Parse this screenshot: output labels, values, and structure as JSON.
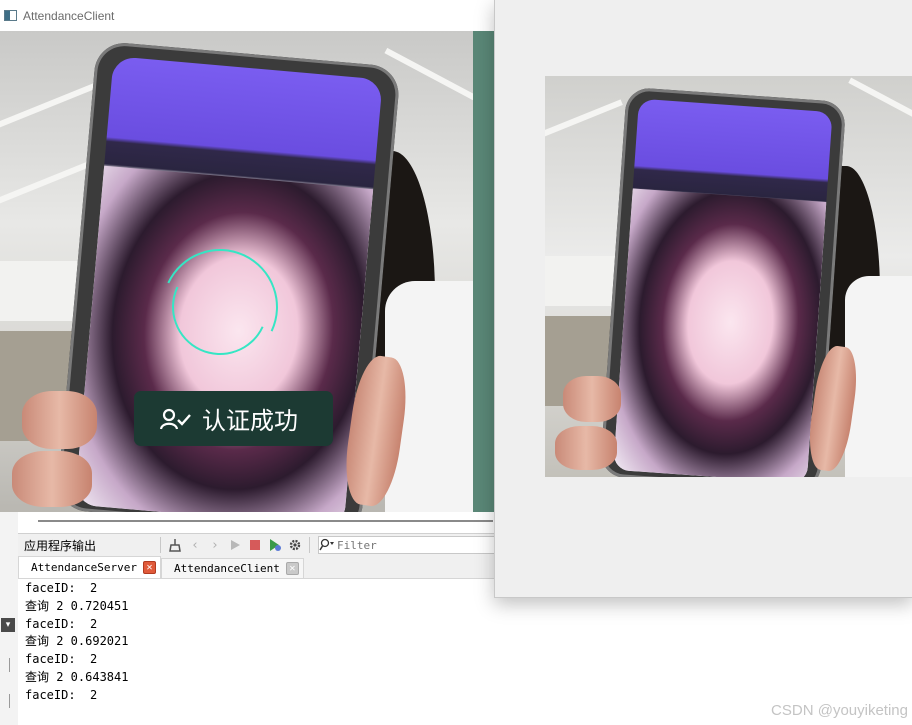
{
  "client_window": {
    "title": "AttendanceClient",
    "toast": {
      "text": "认证成功",
      "icon": "user-check-icon"
    }
  },
  "output_panel": {
    "title": "应用程序输出",
    "filter_placeholder": "Filter",
    "tabs": [
      {
        "label": "AttendanceServer",
        "active": true,
        "close_color": "#e05a3a"
      },
      {
        "label": "AttendanceClient",
        "active": false,
        "close_color": "#c9c9c9"
      }
    ],
    "log_lines": [
      "faceID:  2",
      "查询 2 0.720451",
      "faceID:  2",
      "查询 2 0.692021",
      "faceID:  2",
      "查询 2 0.643841",
      "faceID:  2"
    ]
  },
  "watermark": "CSDN @youyiketing",
  "colors": {
    "toast_bg": "#1c3a33",
    "ring": "#35e6c4",
    "phone_screen_top": "#7a5df0",
    "side_strip": "#5a8777"
  }
}
